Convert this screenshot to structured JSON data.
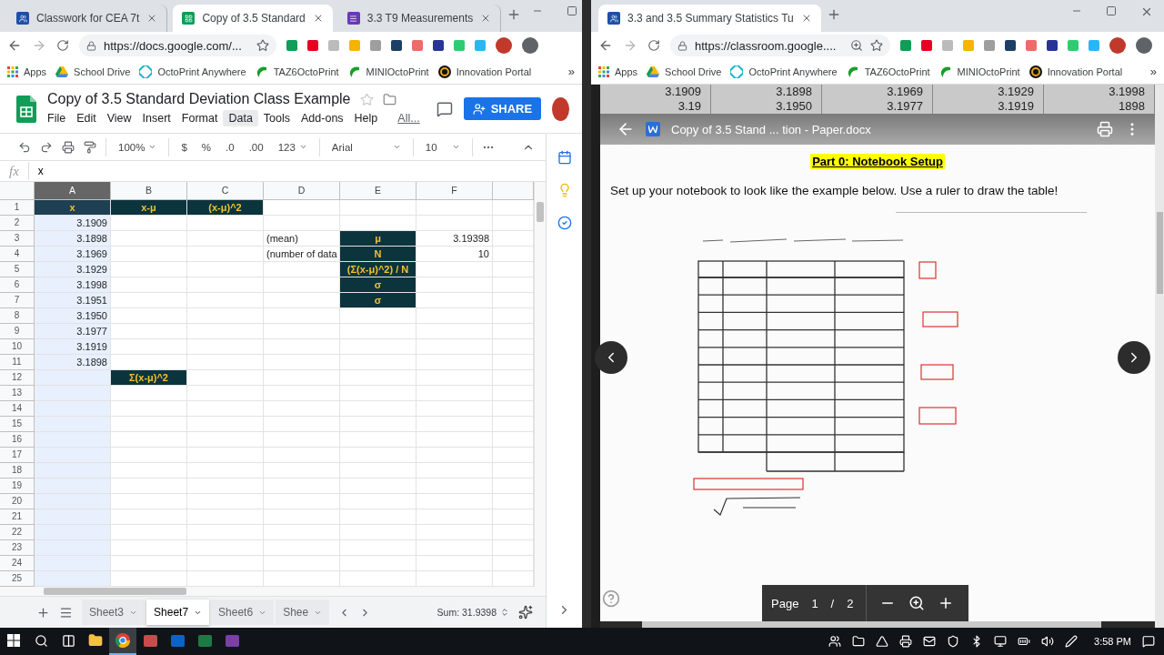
{
  "left_window": {
    "tabs": [
      {
        "title": "Classwork for CEA 7t",
        "kind": "classroom",
        "selected": false
      },
      {
        "title": "Copy of 3.5 Standard",
        "kind": "sheets",
        "selected": true
      },
      {
        "title": "3.3 T9 Measurements",
        "kind": "forms",
        "selected": false
      }
    ],
    "url": "https://docs.google.com/...",
    "bookmarks": [
      {
        "label": "Apps",
        "kind": "apps"
      },
      {
        "label": "School Drive",
        "kind": "drive"
      },
      {
        "label": "OctoPrint Anywhere",
        "kind": "octoprint"
      },
      {
        "label": "TAZ6OctoPrint",
        "kind": "swirl"
      },
      {
        "label": "MINIOctoPrint",
        "kind": "swirl"
      },
      {
        "label": "Innovation Portal",
        "kind": "portal"
      }
    ],
    "bookmarks_more": "»",
    "sheet": {
      "title": "Copy of 3.5 Standard Deviation Class Example",
      "menu": [
        {
          "label": "File",
          "kind": "menu",
          "highlighted": false
        },
        {
          "label": "Edit",
          "kind": "menu",
          "highlighted": false
        },
        {
          "label": "View",
          "kind": "menu",
          "highlighted": false
        },
        {
          "label": "Insert",
          "kind": "menu",
          "highlighted": false
        },
        {
          "label": "Format",
          "kind": "menu",
          "highlighted": false
        },
        {
          "label": "Data",
          "kind": "menu",
          "highlighted": true
        },
        {
          "label": "Tools",
          "kind": "menu",
          "highlighted": false
        },
        {
          "label": "Add-ons",
          "kind": "menu",
          "highlighted": false
        },
        {
          "label": "Help",
          "kind": "menu",
          "highlighted": false
        },
        {
          "label": "All...",
          "kind": "link",
          "highlighted": false
        }
      ],
      "share_label": "SHARE",
      "toolbar": {
        "zoom": "100%",
        "currency": "$",
        "percent": "%",
        "decrease_decimals": ".0",
        "increase_decimals": ".00",
        "more_formats": "123",
        "font": "Arial",
        "font_size": "10"
      },
      "formula_label": "fx",
      "formula_value": "x",
      "columns": [
        {
          "label": "A",
          "selected": true
        },
        {
          "label": "B",
          "selected": false
        },
        {
          "label": "C",
          "selected": false
        },
        {
          "label": "D",
          "selected": false
        },
        {
          "label": "E",
          "selected": false
        },
        {
          "label": "F",
          "selected": false
        }
      ],
      "rows": [
        {
          "number": "1",
          "cells": [
            {
              "kind": "header",
              "text": "x"
            },
            {
              "kind": "header",
              "text": "x-μ"
            },
            {
              "kind": "header",
              "text": "(x-μ)^2"
            }
          ]
        },
        {
          "number": "2",
          "cells": [
            {
              "kind": "number",
              "text": "3.1909"
            }
          ]
        },
        {
          "number": "3",
          "cells": [
            {
              "kind": "number",
              "text": "3.1898"
            },
            {
              "kind": "empty"
            },
            {
              "kind": "empty"
            },
            {
              "kind": "note",
              "text": "(mean)"
            },
            {
              "kind": "header",
              "text": "μ"
            },
            {
              "kind": "number",
              "text": "3.19398"
            }
          ]
        },
        {
          "number": "4",
          "cells": [
            {
              "kind": "number",
              "text": "3.1969"
            },
            {
              "kind": "empty"
            },
            {
              "kind": "empty"
            },
            {
              "kind": "note",
              "text": "(number of data"
            },
            {
              "kind": "header",
              "text": "N"
            },
            {
              "kind": "number",
              "text": "10"
            }
          ]
        },
        {
          "number": "5",
          "cells": [
            {
              "kind": "number",
              "text": "3.1929"
            },
            {
              "kind": "empty"
            },
            {
              "kind": "empty"
            },
            {
              "kind": "empty"
            },
            {
              "kind": "header",
              "text": "(Σ(x-μ)^2) / N"
            }
          ]
        },
        {
          "number": "6",
          "cells": [
            {
              "kind": "number",
              "text": "3.1998"
            },
            {
              "kind": "empty"
            },
            {
              "kind": "empty"
            },
            {
              "kind": "empty"
            },
            {
              "kind": "header",
              "text": "σ"
            }
          ]
        },
        {
          "number": "7",
          "cells": [
            {
              "kind": "number",
              "text": "3.1951"
            },
            {
              "kind": "empty"
            },
            {
              "kind": "empty"
            },
            {
              "kind": "empty"
            },
            {
              "kind": "header",
              "text": "σ"
            }
          ]
        },
        {
          "number": "8",
          "cells": [
            {
              "kind": "number",
              "text": "3.1950"
            }
          ]
        },
        {
          "number": "9",
          "cells": [
            {
              "kind": "number",
              "text": "3.1977"
            }
          ]
        },
        {
          "number": "10",
          "cells": [
            {
              "kind": "number",
              "text": "3.1919"
            }
          ]
        },
        {
          "number": "11",
          "cells": [
            {
              "kind": "number",
              "text": "3.1898"
            }
          ]
        },
        {
          "number": "12",
          "cells": [
            {
              "kind": "empty"
            },
            {
              "kind": "header",
              "text": "Σ(x-μ)^2"
            }
          ]
        },
        {
          "number": "13"
        },
        {
          "number": "14"
        },
        {
          "number": "15"
        },
        {
          "number": "16"
        },
        {
          "number": "17"
        },
        {
          "number": "18"
        },
        {
          "number": "19"
        },
        {
          "number": "20"
        },
        {
          "number": "21"
        },
        {
          "number": "22"
        },
        {
          "number": "23"
        },
        {
          "number": "24"
        },
        {
          "number": "25"
        }
      ],
      "sheet_tabs": [
        {
          "label": "Sheet3",
          "selected": false
        },
        {
          "label": "Sheet7",
          "selected": true
        },
        {
          "label": "Sheet6",
          "selected": false
        },
        {
          "label": "Shee",
          "selected": false
        }
      ],
      "sum": "Sum: 31.9398"
    }
  },
  "right_window": {
    "tabs": [
      {
        "title": "3.3 and 3.5 Summary Statistics Tu",
        "kind": "classroom",
        "selected": true
      }
    ],
    "url": "https://classroom.google....",
    "bookmarks": [
      {
        "label": "Apps",
        "kind": "apps"
      },
      {
        "label": "School Drive",
        "kind": "drive"
      },
      {
        "label": "OctoPrint Anywhere",
        "kind": "octoprint"
      },
      {
        "label": "TAZ6OctoPrint",
        "kind": "swirl"
      },
      {
        "label": "MINIOctoPrint",
        "kind": "swirl"
      },
      {
        "label": "Innovation Portal",
        "kind": "portal"
      }
    ],
    "bookmarks_more": "»",
    "viewer": {
      "table_rows": [
        [
          "3.1909",
          "3.1898",
          "3.1969",
          "3.1929",
          "3.1998"
        ],
        [
          "3.19",
          "3.1950",
          "3.1977",
          "3.1919",
          "1898"
        ]
      ],
      "file_title": "Copy of 3.5 Stand ... tion - Paper.docx",
      "heading": "Part 0: Notebook Setup",
      "instruction": "Set up your notebook to look like the example below. Use a ruler to draw the table!",
      "page_label": "Page",
      "page_current": "1",
      "page_separator": "/",
      "page_total": "2"
    }
  },
  "taskbar": {
    "apps": [
      {
        "kind": "explorer",
        "selected": false
      },
      {
        "kind": "chrome",
        "selected": true
      },
      {
        "kind": "paint",
        "selected": false
      },
      {
        "kind": "outlook",
        "selected": false
      },
      {
        "kind": "excel",
        "selected": false
      },
      {
        "kind": "onenote",
        "selected": false
      }
    ],
    "time": "3:58 PM"
  }
}
